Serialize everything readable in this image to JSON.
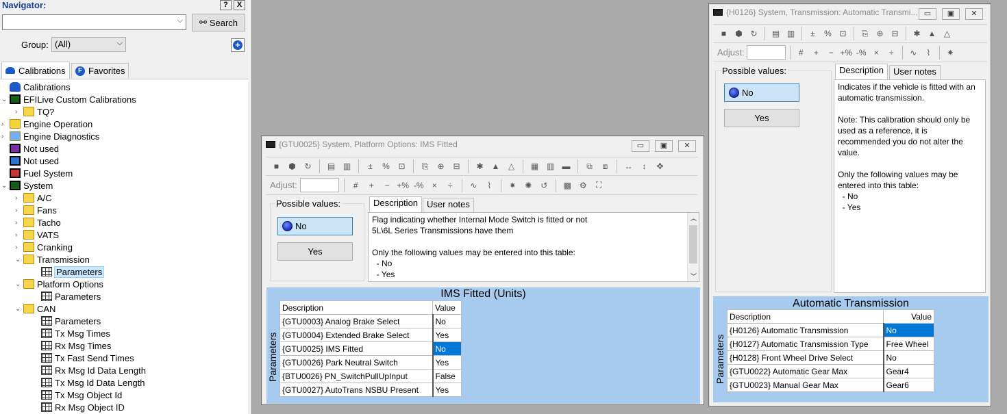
{
  "navigator": {
    "title": "Navigator:",
    "help_label": "?",
    "close_label": "X",
    "search_label": "Search",
    "group_label": "Group:",
    "group_value": "(All)",
    "tabs": [
      {
        "label": "Calibrations"
      },
      {
        "label": "Favorites"
      }
    ],
    "tree": [
      {
        "label": "Calibrations",
        "icon": "car-icon"
      },
      {
        "label": "EFILive Custom Calibrations",
        "icon": "chip-icon"
      },
      {
        "label": "TQ?",
        "icon": "folder-icon"
      },
      {
        "label": "Engine Operation",
        "icon": "engine-icon"
      },
      {
        "label": "Engine Diagnostics",
        "icon": "diagnostics-icon"
      },
      {
        "label": "Not used",
        "icon": "puzzle-icon"
      },
      {
        "label": "Not used",
        "icon": "puzzle-icon"
      },
      {
        "label": "Fuel System",
        "icon": "fuel-icon"
      },
      {
        "label": "System",
        "icon": "chip-icon"
      },
      {
        "label": "A/C",
        "icon": "folder-icon"
      },
      {
        "label": "Fans",
        "icon": "folder-icon"
      },
      {
        "label": "Tacho",
        "icon": "folder-icon"
      },
      {
        "label": "VATS",
        "icon": "folder-icon"
      },
      {
        "label": "Cranking",
        "icon": "folder-icon"
      },
      {
        "label": "Transmission",
        "icon": "folder-icon"
      },
      {
        "label": "Parameters",
        "icon": "table-icon"
      },
      {
        "label": "Platform Options",
        "icon": "folder-icon"
      },
      {
        "label": "Parameters",
        "icon": "table-icon"
      },
      {
        "label": "CAN",
        "icon": "folder-icon"
      },
      {
        "label": "Parameters",
        "icon": "table-icon"
      },
      {
        "label": "Tx Msg Times",
        "icon": "table-icon"
      },
      {
        "label": "Rx Msg Times",
        "icon": "table-icon"
      },
      {
        "label": "Tx Fast Send Times",
        "icon": "table-icon"
      },
      {
        "label": "Rx Msg Id Data Length",
        "icon": "table-icon"
      },
      {
        "label": "Tx Msg Id Data Length",
        "icon": "table-icon"
      },
      {
        "label": "Tx Msg Object Id",
        "icon": "table-icon"
      },
      {
        "label": "Rx Msg Object ID",
        "icon": "table-icon"
      }
    ]
  },
  "win_ims": {
    "title": "{GTU0025} System, Platform Options: IMS Fitted",
    "adjust_label": "Adjust:",
    "possible_values_label": "Possible values:",
    "values": [
      "No",
      "Yes"
    ],
    "tabs": [
      "Description",
      "User notes"
    ],
    "description": "Flag indicating whether Internal Mode Switch is fitted or not\n5L\\6L Series Transmissions have them\n\nOnly the following values may be entered into this table:\n  - No\n  - Yes",
    "table_title": "IMS Fitted (Units)",
    "side_label": "Parameters",
    "col_desc": "Description",
    "col_value": "Value",
    "rows": [
      {
        "desc": "{GTU0003} Analog Brake Select",
        "value": "No"
      },
      {
        "desc": "{GTU0004} Extended Brake Select",
        "value": "Yes"
      },
      {
        "desc": "{GTU0025} IMS Fitted",
        "value": "No"
      },
      {
        "desc": "{GTU0026} Park Neutral Switch",
        "value": "Yes"
      },
      {
        "desc": "{BTU0026} PN_SwitchPullUpInput",
        "value": "False"
      },
      {
        "desc": "{GTU0027} AutoTrans NSBU Present",
        "value": "Yes"
      }
    ]
  },
  "win_auto": {
    "title": "{H0126} System, Transmission: Automatic Transmi...",
    "adjust_label": "Adjust:",
    "possible_values_label": "Possible values:",
    "values": [
      "No",
      "Yes"
    ],
    "tabs": [
      "Description",
      "User notes"
    ],
    "description": "Indicates if the vehicle is fitted with an automatic transmission.\n\nNote: This calibration should only be used as a reference, it is recommended you do not alter the value.\n\nOnly the following values may be entered into this table:\n  - No\n  - Yes",
    "table_title": "Automatic Transmission",
    "side_label": "Parameters",
    "col_desc": "Description",
    "col_value": "Value",
    "rows": [
      {
        "desc": "{H0126} Automatic Transmission",
        "value": "No"
      },
      {
        "desc": "{H0127} Automatic Transmission Type",
        "value": "Free Wheel"
      },
      {
        "desc": "{H0128} Front Wheel Drive Select",
        "value": "No"
      },
      {
        "desc": "{GTU0022} Automatic Gear Max",
        "value": "Gear4"
      },
      {
        "desc": "{GTU0023} Manual Gear Max",
        "value": "Gear6"
      }
    ]
  }
}
